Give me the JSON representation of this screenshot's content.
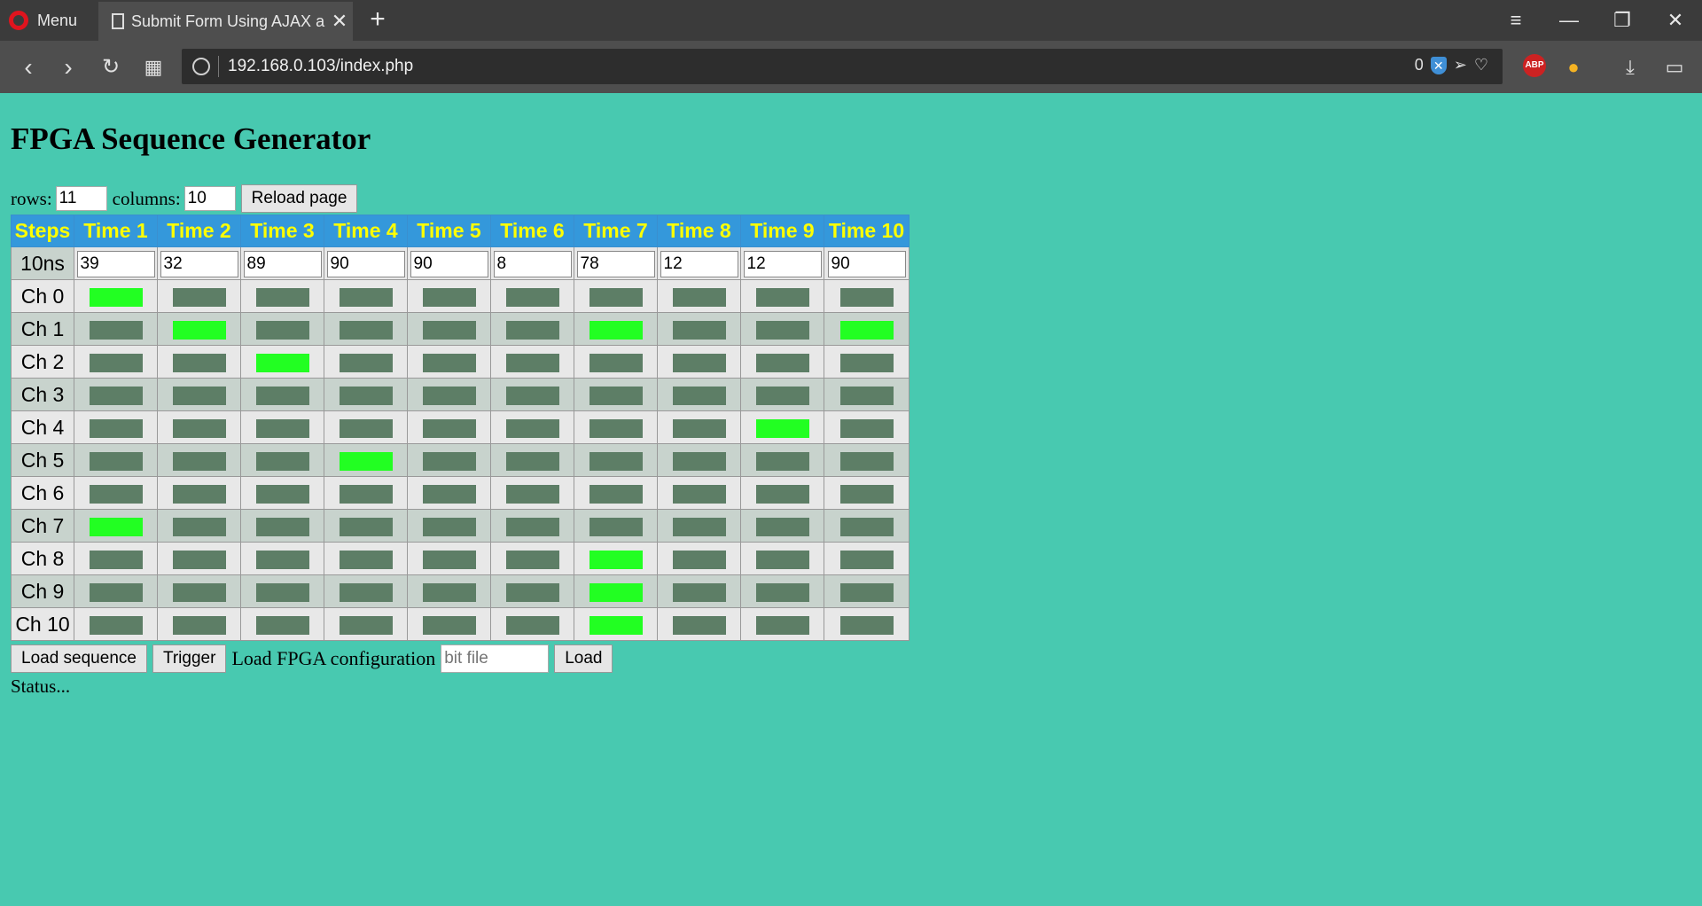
{
  "browser": {
    "menu_label": "Menu",
    "tab_title": "Submit Form Using AJAX a",
    "url": "192.168.0.103/index.php",
    "blocked_count": "0"
  },
  "page": {
    "title": "FPGA Sequence Generator",
    "rows_label": "rows:",
    "rows_value": "11",
    "columns_label": "columns:",
    "columns_value": "10",
    "reload_button": "Reload page",
    "header": [
      "Steps",
      "Time 1",
      "Time 2",
      "Time 3",
      "Time 4",
      "Time 5",
      "Time 6",
      "Time 7",
      "Time 8",
      "Time 9",
      "Time 10"
    ],
    "time_row_label": "10ns",
    "time_values": [
      "39",
      "32",
      "89",
      "90",
      "90",
      "8",
      "78",
      "12",
      "12",
      "90"
    ],
    "channels": [
      {
        "label": "Ch 0",
        "states": [
          1,
          0,
          0,
          0,
          0,
          0,
          0,
          0,
          0,
          0
        ]
      },
      {
        "label": "Ch 1",
        "states": [
          0,
          1,
          0,
          0,
          0,
          0,
          1,
          0,
          0,
          1
        ]
      },
      {
        "label": "Ch 2",
        "states": [
          0,
          0,
          1,
          0,
          0,
          0,
          0,
          0,
          0,
          0
        ]
      },
      {
        "label": "Ch 3",
        "states": [
          0,
          0,
          0,
          0,
          0,
          0,
          0,
          0,
          0,
          0
        ]
      },
      {
        "label": "Ch 4",
        "states": [
          0,
          0,
          0,
          0,
          0,
          0,
          0,
          0,
          1,
          0
        ]
      },
      {
        "label": "Ch 5",
        "states": [
          0,
          0,
          0,
          1,
          0,
          0,
          0,
          0,
          0,
          0
        ]
      },
      {
        "label": "Ch 6",
        "states": [
          0,
          0,
          0,
          0,
          0,
          0,
          0,
          0,
          0,
          0
        ]
      },
      {
        "label": "Ch 7",
        "states": [
          1,
          0,
          0,
          0,
          0,
          0,
          0,
          0,
          0,
          0
        ]
      },
      {
        "label": "Ch 8",
        "states": [
          0,
          0,
          0,
          0,
          0,
          0,
          1,
          0,
          0,
          0
        ]
      },
      {
        "label": "Ch 9",
        "states": [
          0,
          0,
          0,
          0,
          0,
          0,
          1,
          0,
          0,
          0
        ]
      },
      {
        "label": "Ch 10",
        "states": [
          0,
          0,
          0,
          0,
          0,
          0,
          1,
          0,
          0,
          0
        ]
      }
    ],
    "load_sequence_button": "Load sequence",
    "trigger_button": "Trigger",
    "load_fpga_label": "Load FPGA configuration",
    "bit_file_placeholder": "bit file",
    "load_button": "Load",
    "status_text": "Status..."
  },
  "colors": {
    "page_bg": "#48c9b0",
    "header_bg": "#3498db",
    "header_text": "#ffff00",
    "cell_off": "#5d7e66",
    "cell_on": "#22ff22"
  }
}
